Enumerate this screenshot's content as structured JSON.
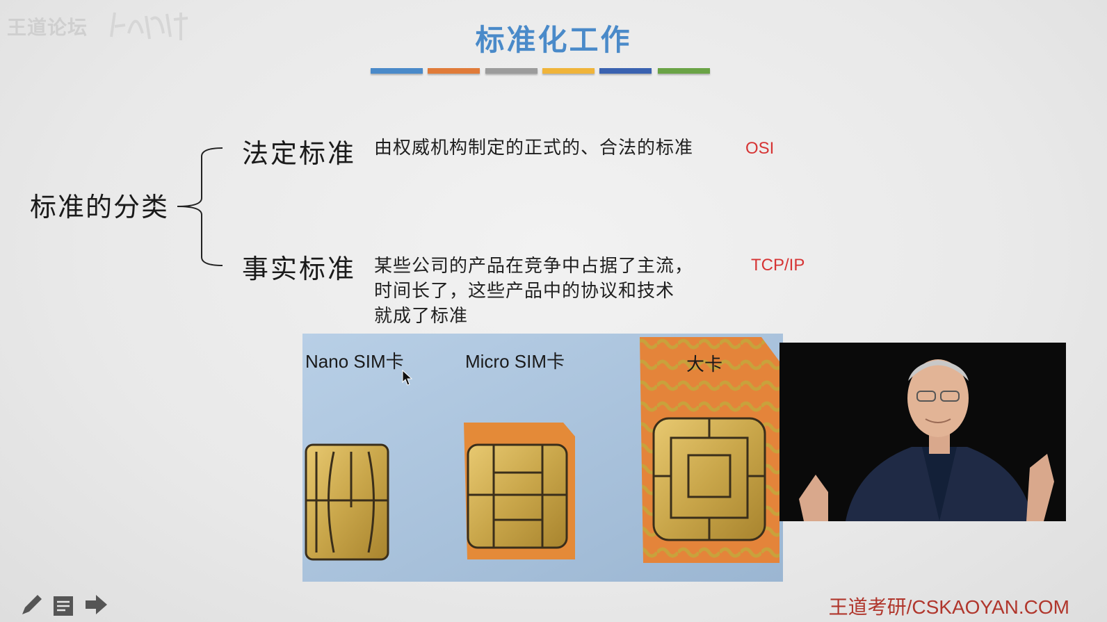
{
  "watermark": {
    "text": "王道论坛"
  },
  "slide": {
    "title": "标准化工作",
    "color_bars": [
      "#4a8ac9",
      "#e07b39",
      "#9c9c9c",
      "#f0b43a",
      "#3a62b0",
      "#6aa346"
    ]
  },
  "classification": {
    "title": "标准的分类",
    "items": [
      {
        "label": "法定标准",
        "description": "由权威机构制定的正式的、合法的标准",
        "example": "OSI"
      },
      {
        "label": "事实标准",
        "description_lines": [
          "某些公司的产品在竞争中占据了主流，",
          "时间长了，这些产品中的协议和技术",
          "就成了标准"
        ],
        "example": "TCP/IP"
      }
    ]
  },
  "sim_photo": {
    "labels": [
      "Nano SIM卡",
      "Micro SIM卡",
      "大卡"
    ]
  },
  "toolbar": {
    "icons": [
      "pen-icon",
      "notes-icon",
      "next-arrow-icon"
    ]
  },
  "footer": {
    "brand": "王道考研/CSKAOYAN.COM"
  }
}
